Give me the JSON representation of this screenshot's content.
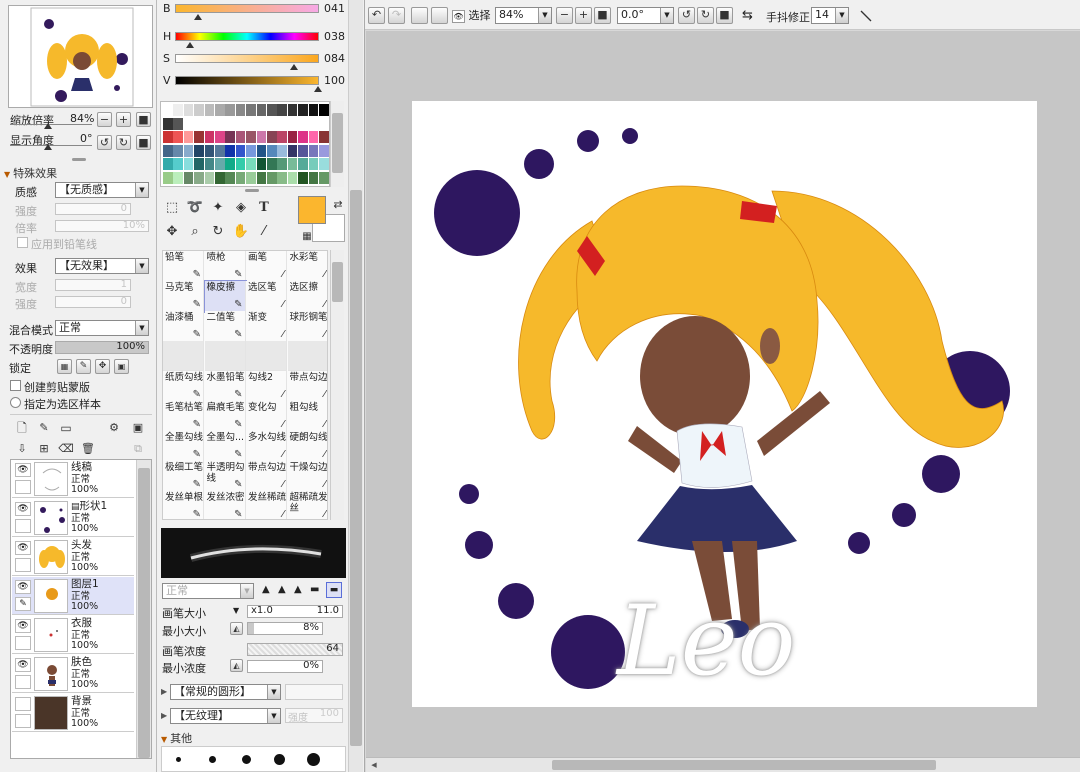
{
  "navigator": {
    "zoom_label": "缩放倍率",
    "zoom_value": "84%",
    "angle_label": "显示角度",
    "angle_value": "0°"
  },
  "effects": {
    "section_title": "特殊效果",
    "texture_label": "质感",
    "texture_value": "【无质感】",
    "strength_label": "强度",
    "strength_value": "0",
    "rate_label": "倍率",
    "rate_value": "10%",
    "apply_pen_label": "应用到铅笔线",
    "effect_label": "效果",
    "effect_value": "【无效果】",
    "width_label": "宽度",
    "width_value": "1",
    "strength2_label": "强度",
    "strength2_value": "0"
  },
  "layer_props": {
    "blend_label": "混合模式",
    "blend_value": "正常",
    "opacity_label": "不透明度",
    "opacity_value": "100%",
    "opacity_fraction": 1.0,
    "lock_label": "锁定",
    "clip_label": "创建剪贴蒙版",
    "sample_label": "指定为选区样本"
  },
  "layers": [
    {
      "name": "线稿",
      "mode": "正常",
      "opacity": "100%"
    },
    {
      "name": "形状1",
      "mode": "正常",
      "opacity": "100%"
    },
    {
      "name": "头发",
      "mode": "正常",
      "opacity": "100%"
    },
    {
      "name": "图层1",
      "mode": "正常",
      "opacity": "100%"
    },
    {
      "name": "衣服",
      "mode": "正常",
      "opacity": "100%"
    },
    {
      "name": "肤色",
      "mode": "正常",
      "opacity": "100%"
    },
    {
      "name": "背景",
      "mode": "正常",
      "opacity": "100%"
    }
  ],
  "color": {
    "b_label": "B",
    "b_value": "041",
    "h_label": "H",
    "h_value": "038",
    "s_label": "S",
    "s_value": "084",
    "v_label": "V",
    "v_value": "100",
    "fg_color": "#fbb62e"
  },
  "brushes": [
    [
      "铅笔",
      "喷枪",
      "画笔",
      "水彩笔"
    ],
    [
      "马克笔",
      "橡皮擦",
      "选区笔",
      "选区擦"
    ],
    [
      "油漆桶",
      "二值笔",
      "渐变",
      "球形钢笔"
    ],
    [
      "",
      "",
      "",
      ""
    ],
    [
      "纸质勾线",
      "水墨铅笔",
      "勾线2",
      "带点勾边"
    ],
    [
      "毛笔枯笔",
      "扁痕毛笔",
      "变化勾",
      "粗勾线"
    ],
    [
      "全墨勾线",
      "全墨勾...",
      "多水勾线",
      "硬朗勾线"
    ],
    [
      "极细工笔",
      "半透明勾线",
      "带点勾边",
      "干燥勾边"
    ],
    [
      "发丝单根",
      "发丝浓密",
      "发丝稀疏",
      "超稀疏发丝"
    ]
  ],
  "brush_settings": {
    "mode_value": "正常",
    "size_label": "画笔大小",
    "size_mult": "x1.0",
    "size_value": "11.0",
    "min_size_label": "最小大小",
    "min_size_value": "8%",
    "min_size_fraction": 0.08,
    "density_label": "画笔浓度",
    "density_value": "64",
    "min_density_label": "最小浓度",
    "min_density_value": "0%",
    "shape_value": "【常规的圆形】",
    "texture_value": "【无纹理】",
    "texture_strength": "强度",
    "texture_strength_value": "100",
    "other_label": "其他"
  },
  "toolbar": {
    "select_label": "选择",
    "zoom_value": "84%",
    "angle_value": "0.0°",
    "stabilizer_label": "手抖修正",
    "stabilizer_value": "14"
  },
  "canvas": {
    "signature": "Leo"
  }
}
